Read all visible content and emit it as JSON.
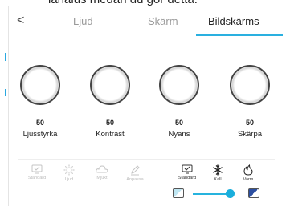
{
  "header_fragment": "lanalus medan du gör detta:",
  "tabs": {
    "back_glyph": "<",
    "items": [
      "Ljud",
      "Skärm",
      "Bildskärms"
    ],
    "active_index": 2
  },
  "knobs": [
    {
      "label": "Ljusstyrka",
      "value": "50"
    },
    {
      "label": "Kontrast",
      "value": "50"
    },
    {
      "label": "Nyans",
      "value": "50"
    },
    {
      "label": "Skärpa",
      "value": "50"
    }
  ],
  "modes_disabled": [
    {
      "label": "Standard",
      "icon": "monitor-icon"
    },
    {
      "label": "Ljud",
      "icon": "sun-icon"
    },
    {
      "label": "Mjukt",
      "icon": "cloud-icon"
    },
    {
      "label": "Anpassa",
      "icon": "pencil-icon"
    }
  ],
  "modes_temperature": [
    {
      "label": "Standard",
      "icon": "monitor-check-icon"
    },
    {
      "label": "Kall",
      "icon": "snowflake-icon"
    },
    {
      "label": "Varm",
      "icon": "flame-icon"
    }
  ],
  "gamma_slider": {
    "value_fraction": 0.8
  },
  "colors": {
    "accent": "#2ab0e0",
    "disabled": "#bbbbbb"
  }
}
